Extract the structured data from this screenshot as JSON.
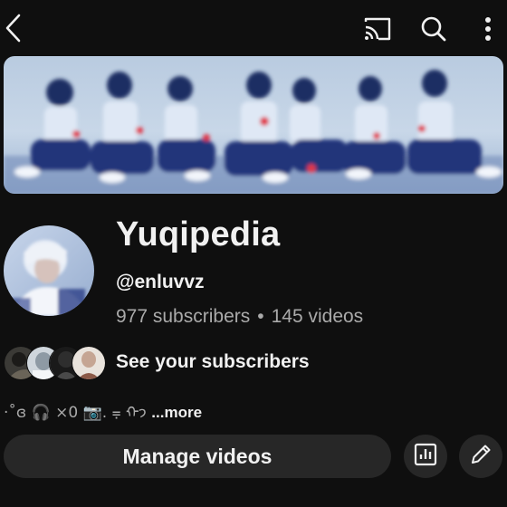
{
  "topbar": {
    "icons": [
      "back-arrow-icon",
      "cast-icon",
      "search-icon",
      "more-vert-icon"
    ]
  },
  "channel": {
    "name": "Yuqipedia",
    "handle": "@enluvvz",
    "subscribers": "977 subscribers",
    "separator": "•",
    "videos": "145 videos"
  },
  "subscribers_preview": {
    "label": "See your subscribers"
  },
  "bio": {
    "text": "·˚ɞ 🎧 ×0 📷. ⩦ ᡣ𐭩",
    "more_label": "...more"
  },
  "actions": {
    "manage_label": "Manage videos",
    "icons": [
      "analytics-icon",
      "edit-pencil-icon"
    ]
  },
  "colors": {
    "background": "#0f0f0f",
    "button_bg": "#272727",
    "primary_text": "#f1f1f1",
    "secondary_text": "#aaaaaa"
  }
}
